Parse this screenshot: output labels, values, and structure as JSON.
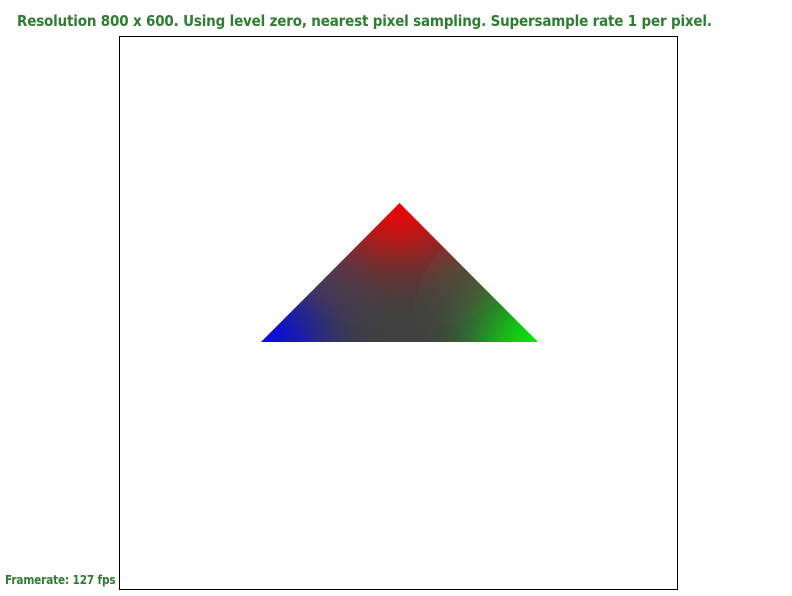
{
  "status": {
    "title": "Resolution 800 x 600. Using level zero, nearest pixel sampling. Supersample rate 1 per pixel.",
    "framerate": "Framerate: 127 fps",
    "text_color": "#2e7d32"
  },
  "viewport": {
    "border_color": "#000000",
    "background": "#ffffff"
  },
  "triangle": {
    "vertex_colors": {
      "top": "#ff0000",
      "bottom_left": "#0000ff",
      "bottom_right": "#00ff00"
    }
  }
}
